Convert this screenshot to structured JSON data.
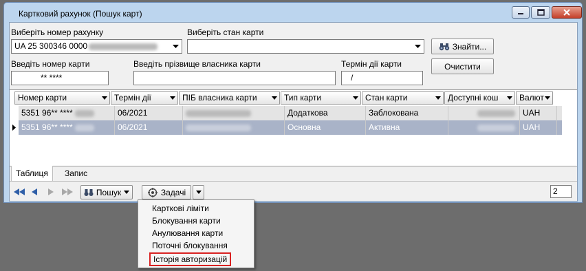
{
  "window": {
    "title": "Картковий рахунок (Пошук карт)"
  },
  "form": {
    "account_label": "Виберіть номер рахунку",
    "account_value": "UA 25 300346 0000",
    "state_label": "Виберіть стан карти",
    "state_value": "",
    "card_number_label": "Введіть номер карти",
    "card_number_value": "** ****",
    "owner_label": "Введіть прізвище власника карти",
    "owner_value": "",
    "expiry_label": "Термін дії карти",
    "expiry_value": "/",
    "find_button": "Знайти...",
    "clear_button": "Очистити"
  },
  "grid": {
    "columns": [
      "Номер карти",
      "Термін дії",
      "ПІБ власника карти",
      "Тип карти",
      "Стан карти",
      "Доступні кош",
      "Валют"
    ],
    "rows": [
      {
        "card_number": "5351 96** ****",
        "expiry": "06/2021",
        "type": "Додаткова",
        "state": "Заблокована",
        "currency": "UAH"
      },
      {
        "card_number": "5351 96** ****",
        "expiry": "06/2021",
        "type": "Основна",
        "state": "Активна",
        "currency": "UAH"
      }
    ]
  },
  "tabs": {
    "table": "Таблиця",
    "record": "Запис"
  },
  "toolbar": {
    "search": "Пошук",
    "tasks": "Задачі",
    "record_count": "2"
  },
  "tasks_menu": {
    "items": [
      "Карткові ліміти",
      "Блокування карти",
      "Анулювання карти",
      "Поточні блокування",
      "Історія авторизацій"
    ]
  }
}
